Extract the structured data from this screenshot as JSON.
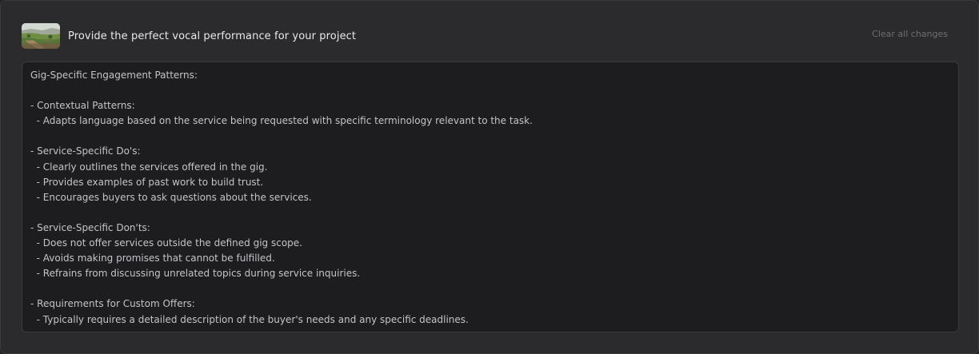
{
  "header": {
    "thumbnail_icon": "landscape-thumbnail",
    "title": "Provide the perfect vocal performance for your project",
    "clear_label": "Clear all changes"
  },
  "content": {
    "lines": [
      "Gig-Specific Engagement Patterns:",
      "",
      "- Contextual Patterns:",
      "  - Adapts language based on the service being requested with specific terminology relevant to the task.",
      "",
      "- Service-Specific Do's:",
      "  - Clearly outlines the services offered in the gig.",
      "  - Provides examples of past work to build trust.",
      "  - Encourages buyers to ask questions about the services.",
      "",
      "- Service-Specific Don'ts:",
      "  - Does not offer services outside the defined gig scope.",
      "  - Avoids making promises that cannot be fulfilled.",
      "  - Refrains from discussing unrelated topics during service inquiries.",
      "",
      "- Requirements for Custom Offers:",
      "  - Typically requires a detailed description of the buyer's needs and any specific deadlines."
    ]
  },
  "colors": {
    "page_bg": "#232325",
    "panel_bg": "#2b2b2d",
    "content_bg": "#1d1d1f",
    "title_text": "#e8e8ea",
    "body_text": "#c4c4c8",
    "muted_text": "#6e6e72"
  }
}
